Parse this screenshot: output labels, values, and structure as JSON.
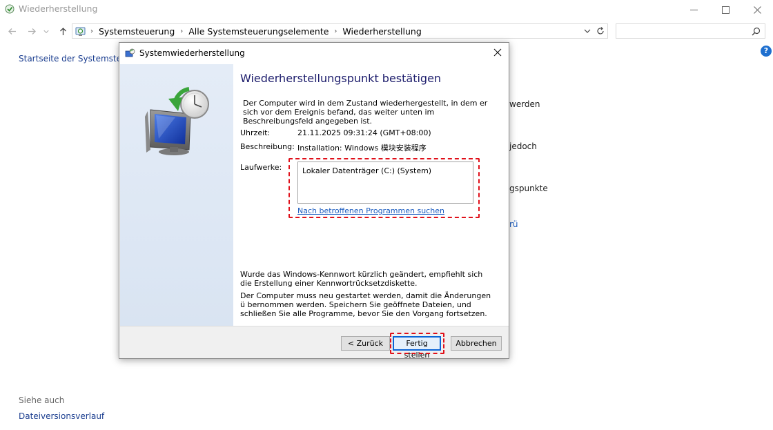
{
  "window": {
    "title": "Wiederherstellung"
  },
  "address_bar": {
    "crumbs": [
      "Systemsteuerung",
      "Alle Systemsteuerungselemente",
      "Wiederherstellung"
    ],
    "search_placeholder": ""
  },
  "sidebar": {
    "home_link": "Startseite der Systemsteuerung"
  },
  "background": {
    "fragments": [
      "werden",
      "jedoch",
      "gspunkte",
      "rü"
    ]
  },
  "see_also": {
    "label": "Siehe auch",
    "link": "Dateiversionsverlauf"
  },
  "dialog": {
    "title": "Systemwiederherstellung",
    "heading": "Wiederherstellungspunkt bestätigen",
    "intro": "Der Computer wird in dem Zustand wiederhergestellt, in dem er sich vor dem Ereignis befand, das weiter unten im Beschreibungsfeld angegeben ist.",
    "time_label": "Uhrzeit:",
    "time_value": "21.11.2025 09:31:24 (GMT+08:00)",
    "desc_label": "Beschreibung:",
    "desc_value": "Installation: Windows 模块安装程序",
    "drives_label": "Laufwerke:",
    "drives": [
      "Lokaler Datenträger (C:) (System)"
    ],
    "affected_link": "Nach betroffenen Programmen suchen",
    "password_note": "Wurde das Windows-Kennwort kürzlich geändert, empfiehlt sich die Erstellung einer Kennwortrücksetzdiskette.",
    "restart_note": "Der Computer muss neu gestartet werden, damit die Änderungen ü bernommen werden. Speichern Sie geöffnete Dateien, und schließen Sie alle Programme, bevor Sie den Vorgang fortsetzen.",
    "buttons": {
      "back": "< Zurück",
      "finish": "Fertig stellen",
      "cancel": "Abbrechen"
    }
  },
  "colors": {
    "highlight": "#e0101a",
    "heading": "#1b1b6b",
    "link": "#1a5bbf"
  }
}
